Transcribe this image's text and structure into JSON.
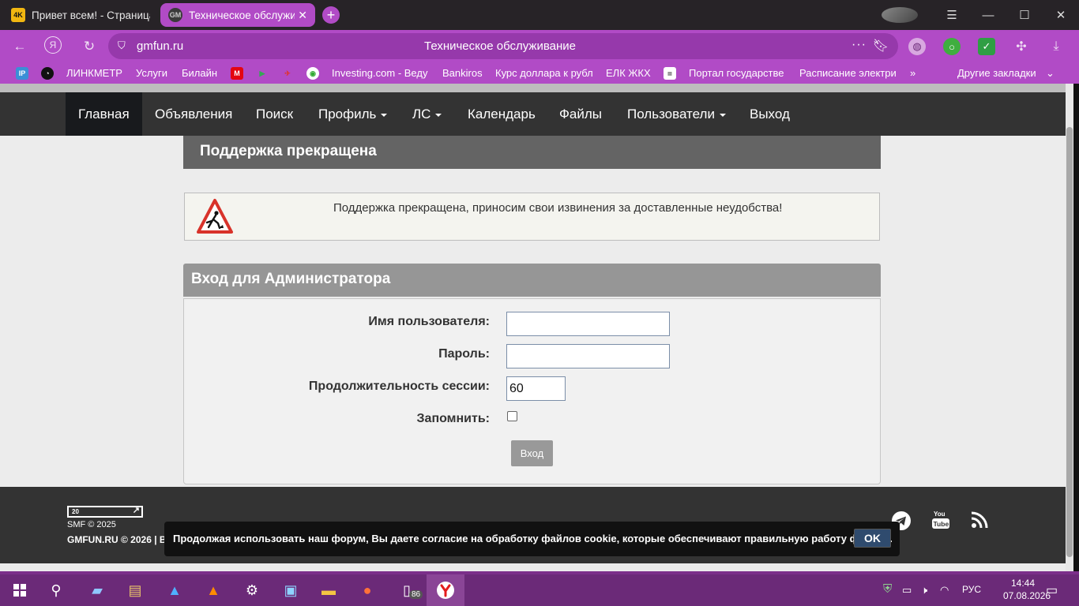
{
  "browser": {
    "tabs": [
      {
        "favicon": "4K",
        "title": "Привет всем! - Страница",
        "active": false
      },
      {
        "favicon": "GM",
        "title": "Техническое обслуживание",
        "active": true
      }
    ],
    "address": {
      "host": "gmfun.ru",
      "page_title": "Техническое обслуживание"
    },
    "bookmarks": [
      "ЛИНКМЕТР",
      "Услуги",
      "Билайн",
      "Investing.com - Веду",
      "Bankiros",
      "Курс доллара к рубл",
      "ЕЛК ЖКХ",
      "Портал государстве",
      "Расписание электри"
    ],
    "bookmark_icons": {
      "ip": "IP"
    },
    "other_bookmarks": "Другие закладки"
  },
  "forum": {
    "nav": {
      "home": "Главная",
      "ads": "Объявления",
      "search": "Поиск",
      "profile": "Профиль",
      "pm": "ЛС",
      "calendar": "Календарь",
      "files": "Файлы",
      "users": "Пользователи",
      "logout": "Выход"
    },
    "maintenance": {
      "title": "Поддержка прекращена",
      "message": "Поддержка прекращена, приносим свои извинения за доставленные неудобства!"
    },
    "login": {
      "title": "Вход для Администратора",
      "username_label": "Имя пользователя:",
      "username_value": "",
      "password_label": "Пароль:",
      "password_value": "",
      "session_label": "Продолжительность сессии:",
      "session_value": "60",
      "remember_label": "Запомнить:",
      "remember_checked": false,
      "submit": "Вход"
    },
    "footer": {
      "logo_text": "20",
      "smf": "SMF © 2025",
      "copyright": "GMFUN.RU © 2026 | В"
    },
    "cookie": {
      "text": "Продолжая использовать наш форум, Вы даете согласие на обработку файлов cookie, которые обеспечивают правильную работу форума.",
      "ok": "OK"
    }
  },
  "taskbar": {
    "battery_badge": "86",
    "lang": "РУС",
    "time": "14:44",
    "date": "07.08.2026"
  },
  "colors": {
    "accent": "#b14bc6",
    "nav_bg": "#333333",
    "header_dark": "#646464",
    "header_light": "#969696"
  }
}
